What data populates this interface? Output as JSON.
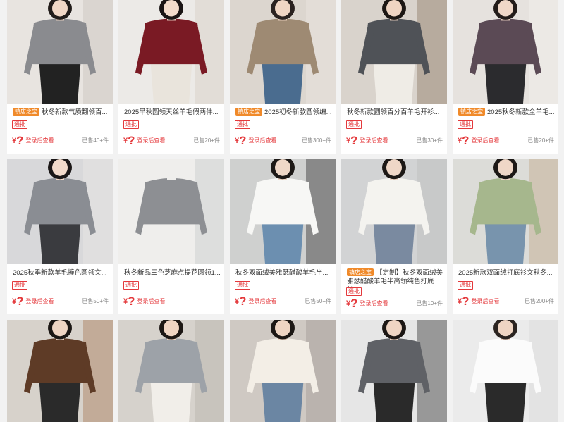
{
  "products": [
    {
      "title": "秋冬新款气质翻领百...",
      "shop_badge": "镇店之宝",
      "tag": "通批",
      "price_symbol": "¥",
      "price_hidden": "?",
      "login_prompt": "登录后查看",
      "sold": "已售40+件",
      "image": {
        "bg": "#e8e4e0",
        "skin": "#f1d7c6",
        "hair": "#221c1a",
        "top": "#8a8b8f",
        "bottom": "#222222",
        "accent": "#c9c3bd"
      }
    },
    {
      "title": "2025早秋圆领天丝羊毛假两件...",
      "shop_badge": "",
      "tag": "通批",
      "price_symbol": "¥",
      "price_hidden": "?",
      "login_prompt": "登录后查看",
      "sold": "已售20+件",
      "image": {
        "bg": "#eceae7",
        "skin": "#f3dccc",
        "hair": "#1a1515",
        "top": "#7a1a24",
        "bottom": "#e9e4dc",
        "accent": "#d8cfc4"
      }
    },
    {
      "title": "2025初冬新款圆领编...",
      "shop_badge": "镇店之宝",
      "tag": "通批",
      "price_symbol": "¥",
      "price_hidden": "?",
      "login_prompt": "登录后查看",
      "sold": "已售300+件",
      "image": {
        "bg": "#dcd6cf",
        "skin": "#f0d6c4",
        "hair": "#2a2220",
        "top": "#9e8a73",
        "bottom": "#4a6c8f",
        "accent": "#ece7df"
      }
    },
    {
      "title": "秋冬新款圆领百分百羊毛开衫...",
      "shop_badge": "",
      "tag": "通批",
      "price_symbol": "¥",
      "price_hidden": "?",
      "login_prompt": "登录后查看",
      "sold": "已售30+件",
      "image": {
        "bg": "#d9d3cc",
        "skin": "#efd5c3",
        "hair": "#1c1714",
        "top": "#4f5257",
        "bottom": "#efece6",
        "accent": "#8f7b66"
      }
    },
    {
      "title": "2025秋冬新款全羊毛...",
      "shop_badge": "镇店之宝",
      "tag": "通批",
      "price_symbol": "¥",
      "price_hidden": "?",
      "login_prompt": "登录后查看",
      "sold": "已售20+件",
      "image": {
        "bg": "#e6e2de",
        "skin": "#f0d8c8",
        "hair": "#231c1a",
        "top": "#5b4a55",
        "bottom": "#2b2b2e",
        "accent": "#f4f1ee"
      }
    },
    {
      "title": "2025秋季新款羊毛撞色圆领文...",
      "shop_badge": "",
      "tag": "通批",
      "price_symbol": "¥",
      "price_hidden": "?",
      "login_prompt": "登录后查看",
      "sold": "已售50+件",
      "image": {
        "bg": "#d8d8da",
        "skin": "#f2dacb",
        "hair": "#1b1717",
        "top": "#8a8d93",
        "bottom": "#3a3b3f",
        "accent": "#ece9e5"
      }
    },
    {
      "title": "秋冬新品三色芝麻点提花圆领1...",
      "shop_badge": "",
      "tag": "通批",
      "price_symbol": "¥",
      "price_hidden": "?",
      "login_prompt": "登录后查看",
      "sold": "",
      "image": {
        "bg": "#efeeec",
        "skin": "#efeeec",
        "hair": "#efeeec",
        "top": "#8d8f93",
        "bottom": "#efeeec",
        "accent": "#c7c9cc"
      }
    },
    {
      "title": "秋冬双面绒美雅瑟醋酸羊毛半...",
      "shop_badge": "",
      "tag": "通批",
      "price_symbol": "¥",
      "price_hidden": "?",
      "login_prompt": "登录后查看",
      "sold": "已售50+件",
      "image": {
        "bg": "#cfd0cf",
        "skin": "#efd7c7",
        "hair": "#1c1816",
        "top": "#f7f7f5",
        "bottom": "#6c8fb0",
        "accent": "#333333"
      }
    },
    {
      "title": "【定制】秋冬双面绒美雅瑟醋酸羊毛半高领纯色打底衫...",
      "shop_badge": "镇店之宝",
      "tag": "通批",
      "price_symbol": "¥",
      "price_hidden": "?",
      "login_prompt": "登录后查看",
      "sold": "已售10+件",
      "image": {
        "bg": "#d2d3d4",
        "skin": "#efd7c7",
        "hair": "#1c1816",
        "top": "#f4f3ef",
        "bottom": "#7a8aa0",
        "accent": "#bdbdbd"
      }
    },
    {
      "title": "2025新款双面绒打底衫文秋冬...",
      "shop_badge": "",
      "tag": "通批",
      "price_symbol": "¥",
      "price_hidden": "?",
      "login_prompt": "登录后查看",
      "sold": "已售200+件",
      "image": {
        "bg": "#dcdcd8",
        "skin": "#efd7c7",
        "hair": "#1c1816",
        "top": "#a6b78d",
        "bottom": "#7894ad",
        "accent": "#c2a88c"
      }
    },
    {
      "title": "",
      "shop_badge": "",
      "tag": "",
      "price_symbol": "",
      "price_hidden": "",
      "login_prompt": "",
      "sold": "",
      "image": {
        "bg": "#d7d2cb",
        "skin": "#efd5c3",
        "hair": "#1c1714",
        "top": "#5e3b26",
        "bottom": "#2a2a2a",
        "accent": "#a97c5b"
      }
    },
    {
      "title": "",
      "shop_badge": "",
      "tag": "",
      "price_symbol": "",
      "price_hidden": "",
      "login_prompt": "",
      "sold": "",
      "image": {
        "bg": "#d6d2cc",
        "skin": "#efd5c3",
        "hair": "#1c1714",
        "top": "#9da2a8",
        "bottom": "#f1eee9",
        "accent": "#b9b3ab"
      }
    },
    {
      "title": "",
      "shop_badge": "",
      "tag": "",
      "price_symbol": "",
      "price_hidden": "",
      "login_prompt": "",
      "sold": "",
      "image": {
        "bg": "#cfc9c3",
        "skin": "#efd5c3",
        "hair": "#1c1714",
        "top": "#f3eee6",
        "bottom": "#6b86a3",
        "accent": "#9f9a94"
      }
    },
    {
      "title": "",
      "shop_badge": "",
      "tag": "",
      "price_symbol": "",
      "price_hidden": "",
      "login_prompt": "",
      "sold": "",
      "image": {
        "bg": "#e6e6e6",
        "skin": "#efd5c3",
        "hair": "#1c1714",
        "top": "#5f6166",
        "bottom": "#2a2a2a",
        "accent": "#3a3a3a"
      }
    },
    {
      "title": "",
      "shop_badge": "",
      "tag": "",
      "price_symbol": "",
      "price_hidden": "",
      "login_prompt": "",
      "sold": "",
      "image": {
        "bg": "#ebebeb",
        "skin": "#efd5c3",
        "hair": "#2a2320",
        "top": "#fbfbfb",
        "bottom": "#2a2a2a",
        "accent": "#d9d9d9"
      }
    }
  ]
}
